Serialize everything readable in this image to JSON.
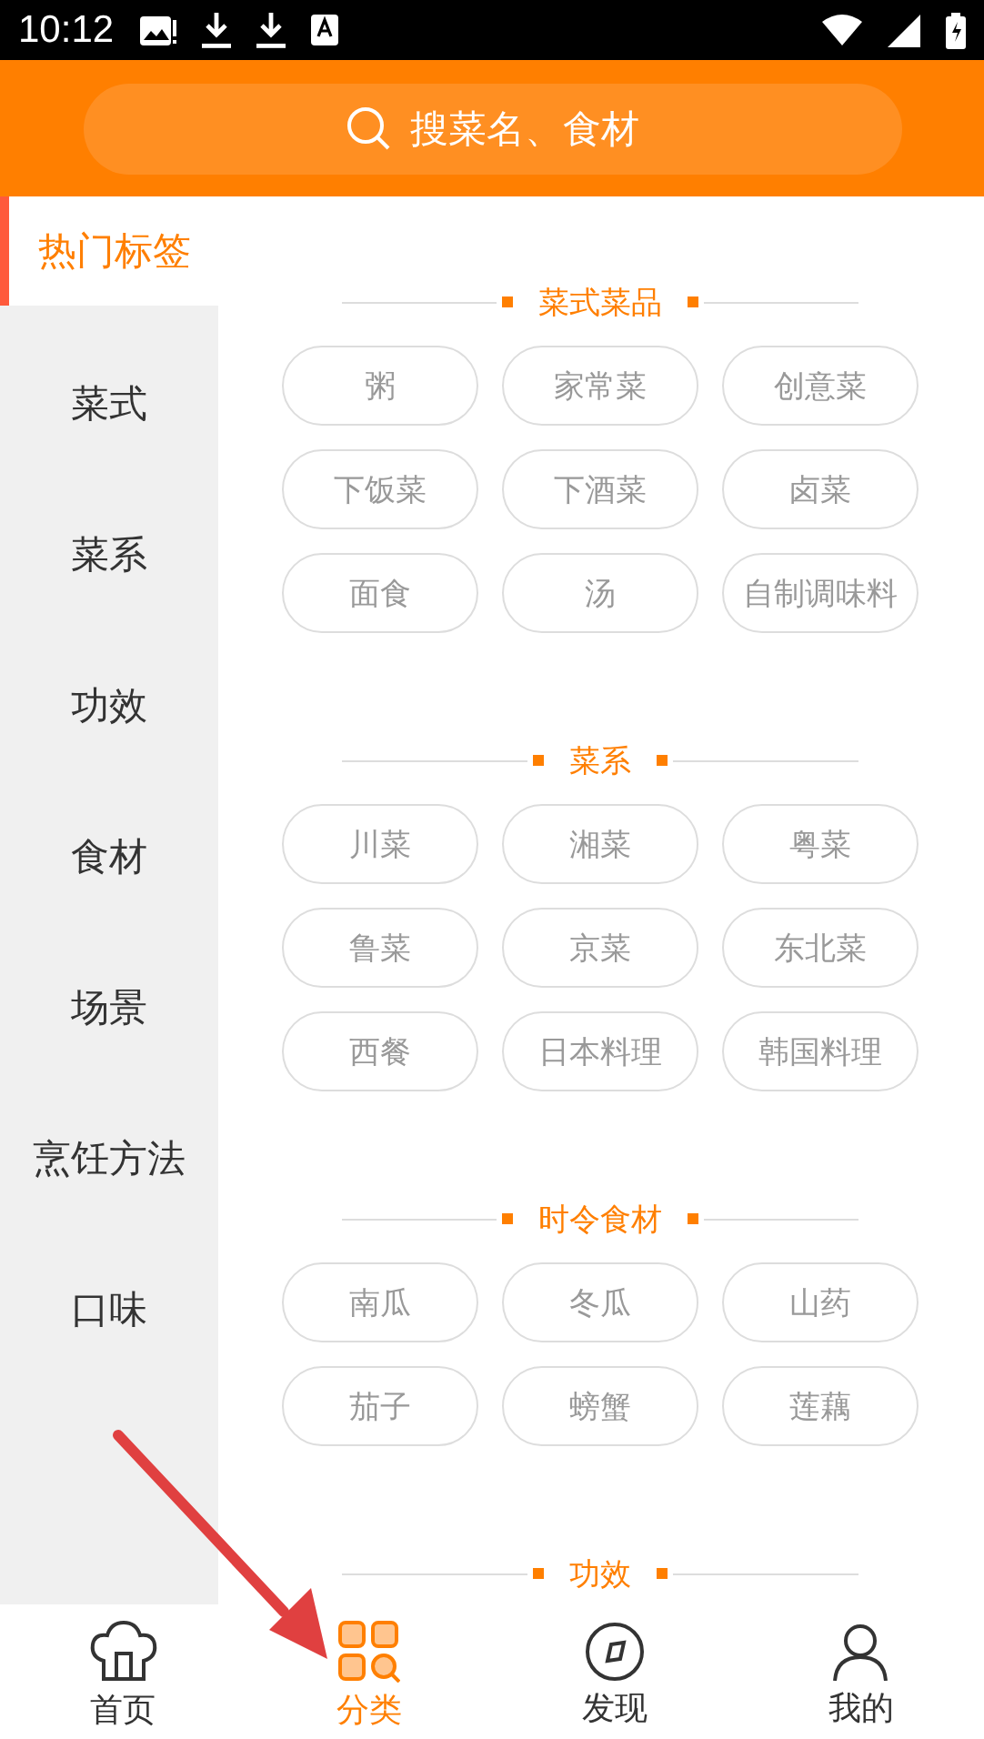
{
  "status_bar": {
    "time": "10:12"
  },
  "search": {
    "placeholder": "搜菜名、食材"
  },
  "sidebar": {
    "items": [
      {
        "label": "热门标签",
        "selected": true
      },
      {
        "label": "菜式",
        "selected": false
      },
      {
        "label": "菜系",
        "selected": false
      },
      {
        "label": "功效",
        "selected": false
      },
      {
        "label": "食材",
        "selected": false
      },
      {
        "label": "场景",
        "selected": false
      },
      {
        "label": "烹饪方法",
        "selected": false
      },
      {
        "label": "口味",
        "selected": false
      }
    ]
  },
  "sections": [
    {
      "title": "菜式菜品",
      "tags": [
        "粥",
        "家常菜",
        "创意菜",
        "下饭菜",
        "下酒菜",
        "卤菜",
        "面食",
        "汤",
        "自制调味料"
      ]
    },
    {
      "title": "菜系",
      "tags": [
        "川菜",
        "湘菜",
        "粤菜",
        "鲁菜",
        "京菜",
        "东北菜",
        "西餐",
        "日本料理",
        "韩国料理"
      ]
    },
    {
      "title": "时令食材",
      "tags": [
        "南瓜",
        "冬瓜",
        "山药",
        "茄子",
        "螃蟹",
        "莲藕"
      ]
    },
    {
      "title": "功效"
    }
  ],
  "bottom_nav": [
    {
      "label": "首页",
      "kind": "home",
      "selected": false
    },
    {
      "label": "分类",
      "kind": "category",
      "selected": true
    },
    {
      "label": "发现",
      "kind": "discover",
      "selected": false
    },
    {
      "label": "我的",
      "kind": "profile",
      "selected": false
    }
  ]
}
